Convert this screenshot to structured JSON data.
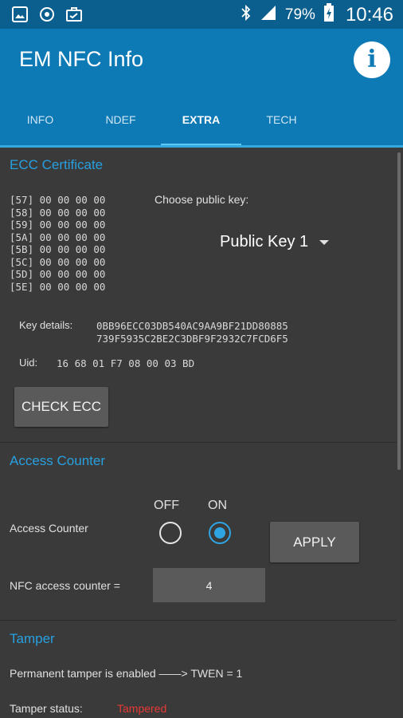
{
  "status_bar": {
    "battery": "79%",
    "time": "10:46",
    "icons": [
      "gallery-icon",
      "sync-icon",
      "briefcase-icon",
      "bluetooth-icon",
      "signal-icon",
      "battery-charging-icon"
    ]
  },
  "app": {
    "title": "EM NFC Info",
    "info_icon": "i",
    "tabs": [
      {
        "label": "INFO",
        "active": false
      },
      {
        "label": "NDEF",
        "active": false
      },
      {
        "label": "EXTRA",
        "active": true
      },
      {
        "label": "TECH",
        "active": false
      }
    ]
  },
  "ecc": {
    "title": "ECC Certificate",
    "rows": [
      "[57] 00 00 00 00",
      "[58] 00 00 00 00",
      "[59] 00 00 00 00",
      "[5A] 00 00 00 00",
      "[5B] 00 00 00 00",
      "[5C] 00 00 00 00",
      "[5D] 00 00 00 00",
      "[5E] 00 00 00 00"
    ],
    "choose_label": "Choose public key:",
    "selected_key": "Public Key 1",
    "key_details_label": "Key details:",
    "key_details_line1": "0BB96ECC03DB540AC9AA9BF21DD80885",
    "key_details_line2": "739F5935C2BE2C3DBF9F2932C7FCD6F5",
    "uid_label": "Uid:",
    "uid_value": "16 68 01 F7 08 00 03 BD",
    "check_button": "CHECK ECC"
  },
  "access_counter": {
    "title": "Access Counter",
    "off_label": "OFF",
    "on_label": "ON",
    "row_label": "Access Counter",
    "selected": "ON",
    "apply_button": "APPLY",
    "nfc_counter_label": "NFC access counter =",
    "nfc_counter_value": "4"
  },
  "tamper": {
    "title": "Tamper",
    "permanent_text": "Permanent tamper is enabled ——> TWEN = 1",
    "status_label": "Tamper status:",
    "status_value": "Tampered",
    "status_color": "#e53935"
  },
  "colors": {
    "statusbar": "#0a5f8e",
    "appbar": "#0d79b5",
    "accent": "#27a0e0",
    "background": "#3a3a3a"
  }
}
